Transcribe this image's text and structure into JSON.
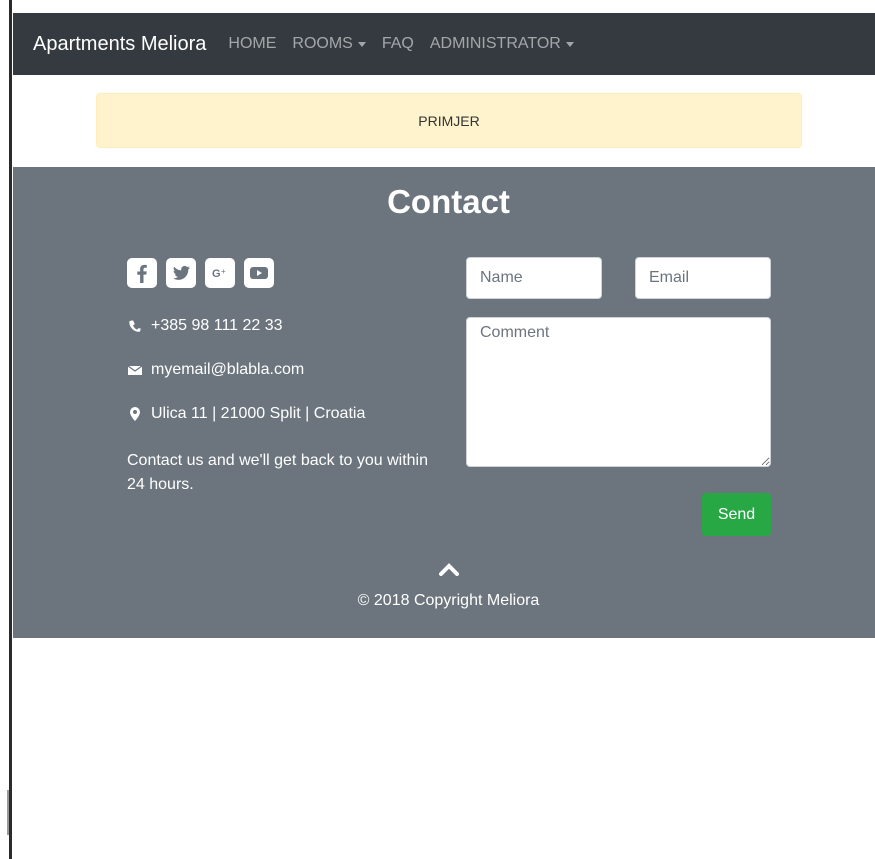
{
  "navbar": {
    "brand": "Apartments Meliora",
    "links": [
      {
        "label": "HOME"
      },
      {
        "label": "ROOMS"
      },
      {
        "label": "FAQ"
      },
      {
        "label": "ADMINISTRATOR"
      }
    ]
  },
  "alert": {
    "text": "PRIMJER"
  },
  "contact": {
    "title": "Contact",
    "social_icons": [
      "facebook-icon",
      "twitter-icon",
      "google-plus-icon",
      "youtube-icon"
    ],
    "phone": "+385 98 111 22 33",
    "email": "myemail@blabla.com",
    "address": "Ulica 11 | 21000 Split | Croatia",
    "blurb": "Contact us and we'll get back to you within 24 hours.",
    "form": {
      "name_placeholder": "Name",
      "email_placeholder": "Email",
      "comment_placeholder": "Comment",
      "send_label": "Send"
    }
  },
  "footer": {
    "copyright": "© 2018 Copyright Meliora"
  },
  "colors": {
    "navbar_bg": "#343a40",
    "alert_bg": "#fff3cd",
    "section_bg": "#6c757d",
    "send_button": "#28a745"
  }
}
